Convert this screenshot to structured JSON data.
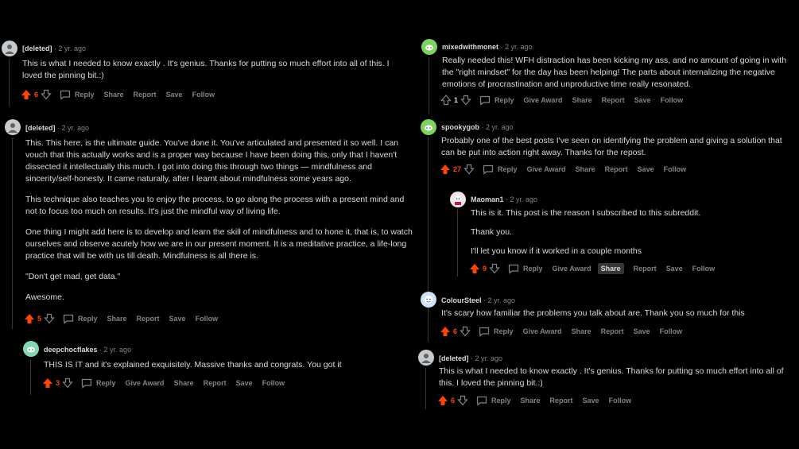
{
  "labels": {
    "reply": "Reply",
    "give_award": "Give Award",
    "share": "Share",
    "report": "Report",
    "save": "Save",
    "follow": "Follow"
  },
  "colors": {
    "upvoted": "#ff4500",
    "muted": "#818384",
    "text": "#d7dadc",
    "thread": "#343536"
  },
  "left": [
    {
      "author": "[deleted]",
      "time": "· 2 yr. ago",
      "paragraphs": [
        "This is what I needed to know exactly . It's genius. Thanks for putting so much effort into all of this. I loved the pinning bit.:)"
      ],
      "score": "6"
    },
    {
      "author": "[deleted]",
      "time": "· 2 yr. ago",
      "paragraphs": [
        "This. This here, is the ultimate guide. You've done it. You've articulated and presented it so well. I can vouch that this actually works and is a proper way because I have been doing this, only that I haven't dissected it intellectually this much. I got into doing this through two things — mindfulness and sincerity/self-honesty. It came naturally, after I learnt about mindfulness some years ago.",
        "This technique also teaches you to enjoy the process, to go along the process with a present mind and not to focus too much on results. It's just the mindful way of living life.",
        "One thing I might add here is to develop and learn the skill of mindfulness and to hone it, that is, to watch ourselves and observe acutely how we are in our present moment. It is a meditative practice, a life-long practice that will be with us till death. Mindfulness is all there is.",
        "\"Don't get mad, get data.\"",
        "Awesome."
      ],
      "score": "5"
    },
    {
      "author": "deepchocflakes",
      "time": "· 2 yr. ago",
      "paragraphs": [
        "THIS IS IT and it's explained exquisitely. Massive thanks and congrats. You got it"
      ],
      "score": "3"
    }
  ],
  "right": [
    {
      "author": "mixedwithmonet",
      "time": "· 2 yr. ago",
      "paragraphs": [
        "Really needed this! WFH distraction has been kicking my ass, and no amount of going in with the \"right mindset\" for the day has been helping! The parts about internalizing the negative emotions of procrastination and unproductive time really resonated."
      ],
      "score": "1"
    },
    {
      "author": "spookygob",
      "time": "· 2 yr. ago",
      "paragraphs": [
        "Probably one of the best posts I've seen on identifying the problem and giving a solution that can be put into action right away. Thanks for the repost."
      ],
      "score": "27"
    },
    {
      "author": "Maoman1",
      "time": "· 2 yr. ago",
      "paragraphs": [
        "This is it. This post is the reason I subscribed to this subreddit.",
        "Thank you.",
        "I'll let you know if it worked in a couple months"
      ],
      "score": "9"
    },
    {
      "author": "ColourSteel",
      "time": "· 2 yr. ago",
      "paragraphs": [
        "It's scary how familiar the problems you talk about are. Thank you so much for this"
      ],
      "score": "6"
    },
    {
      "author": "[deleted]",
      "time": "· 2 yr. ago",
      "paragraphs": [
        "This is what I needed to know exactly . It's genius. Thanks for putting so much effort into all of this. I loved the pinning bit.:)"
      ],
      "score": "6"
    }
  ]
}
